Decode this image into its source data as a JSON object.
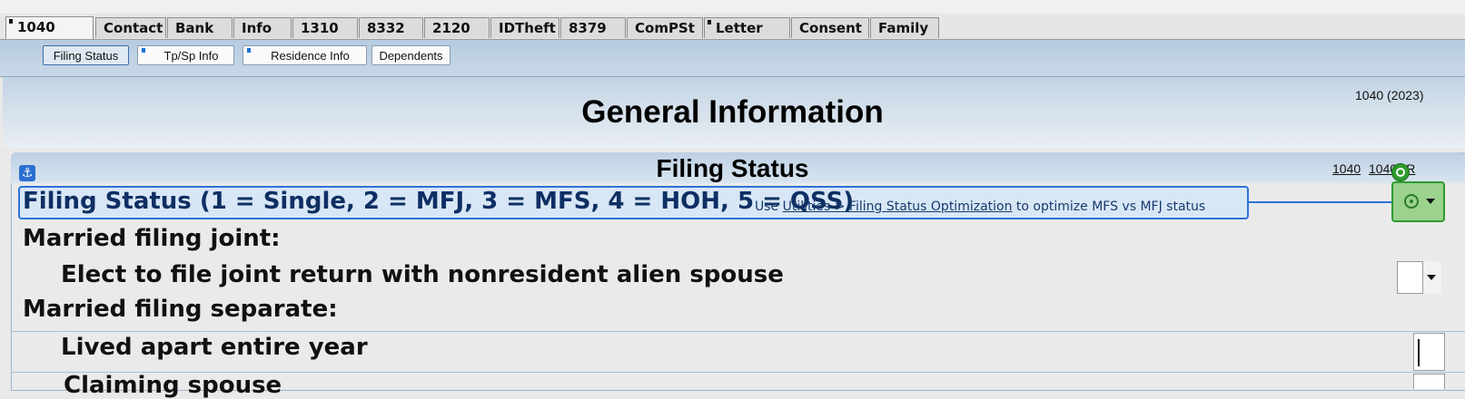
{
  "form_tabs": [
    {
      "label": "1040",
      "marked": true
    },
    {
      "label": "Contact",
      "marked": false
    },
    {
      "label": "Bank",
      "marked": false
    },
    {
      "label": "Info",
      "marked": false
    },
    {
      "label": "1310",
      "marked": false
    },
    {
      "label": "8332",
      "marked": false
    },
    {
      "label": "2120",
      "marked": false
    },
    {
      "label": "IDTheft",
      "marked": false
    },
    {
      "label": "8379",
      "marked": false
    },
    {
      "label": "ComPSt",
      "marked": false
    },
    {
      "label": "Letter",
      "marked": true
    },
    {
      "label": "Consent",
      "marked": false
    },
    {
      "label": "Family",
      "marked": false
    }
  ],
  "sub_tabs": [
    {
      "label": "Filing Status",
      "marked": false,
      "active": true
    },
    {
      "label": "Tp/Sp Info",
      "marked": true,
      "active": false
    },
    {
      "label": "Residence Info",
      "marked": true,
      "active": false
    },
    {
      "label": "Dependents",
      "marked": false,
      "active": false
    }
  ],
  "page": {
    "title": "General Information",
    "form_version": "1040 (2023)"
  },
  "section": {
    "title": "Filing Status",
    "anchor_icon": "anchor-icon",
    "links": [
      "1040",
      "1040NR"
    ]
  },
  "filing_status": {
    "label": "Filing Status (1 = Single, 2 = MFJ, 3 = MFS, 4 = HOH, 5 = QSS)",
    "note_prefix": "Use ",
    "note_link": "Utilities > Filing Status Optimization",
    "note_suffix": " to optimize MFS vs MFJ status",
    "value": ""
  },
  "rows": {
    "mfj_heading": "Married filing joint:",
    "elect_joint": "Elect to file joint return with nonresident alien spouse",
    "mfs_heading": "Married filing separate:",
    "lived_apart": "Lived apart entire year",
    "claiming_spouse": "Claiming spouse"
  },
  "colors": {
    "accent": "#2c72d6",
    "field_active": "#9bd28e",
    "header_band": "#c3d4e5"
  }
}
